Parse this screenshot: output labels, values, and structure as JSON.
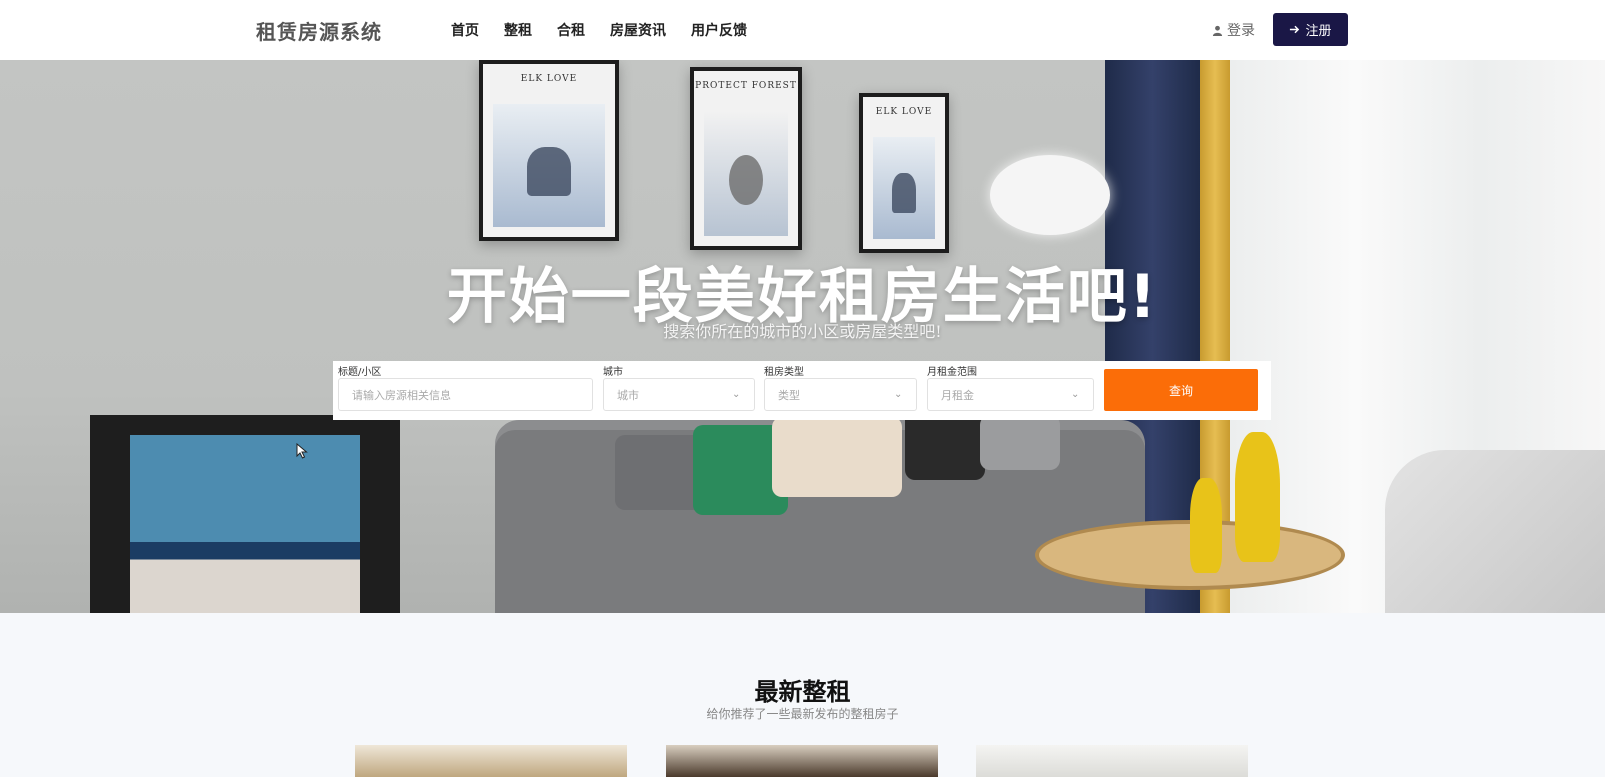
{
  "header": {
    "brand": "租赁房源系统",
    "nav": [
      "首页",
      "整租",
      "合租",
      "房屋资讯",
      "用户反馈"
    ],
    "login": "登录",
    "register": "注册"
  },
  "hero": {
    "title": "开始一段美好租房生活吧!",
    "subtitle": "搜索你所在的城市的小区或房屋类型吧!",
    "paintings": [
      "ELK LOVE",
      "PROTECT FOREST",
      "ELK LOVE"
    ]
  },
  "search": {
    "title_label": "标题/小区",
    "title_placeholder": "请输入房源相关信息",
    "city_label": "城市",
    "city_value": "城市",
    "type_label": "租房类型",
    "type_value": "类型",
    "rent_label": "月租金范围",
    "rent_value": "月租金",
    "query": "查询"
  },
  "latest": {
    "title": "最新整租",
    "subtitle": "给你推荐了一些最新发布的整租房子"
  },
  "colors": {
    "accent": "#fb6d08",
    "brand_dark": "#1a1746"
  }
}
